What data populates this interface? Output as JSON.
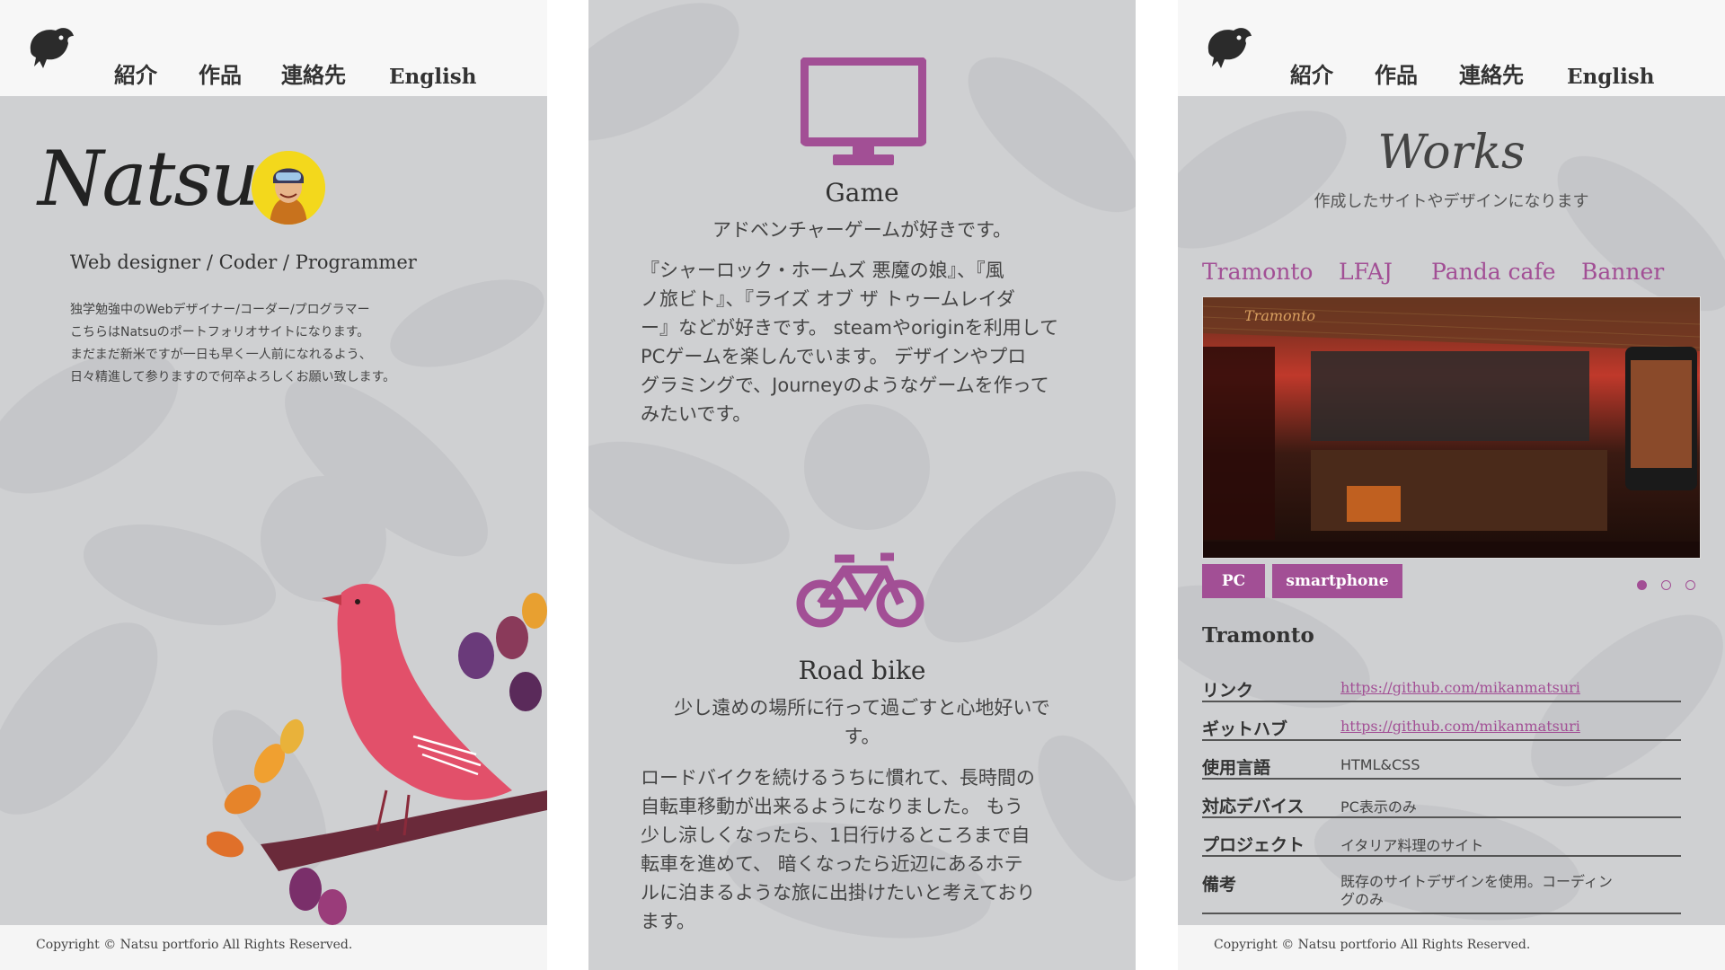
{
  "colors": {
    "accent": "#a24f95",
    "panel_bg": "#cfd0d2",
    "header_bg": "#f7f7f7"
  },
  "nav": {
    "intro": "紹介",
    "works": "作品",
    "contact": "連絡先",
    "english": "English"
  },
  "footer": {
    "copyright": "Copyright © Natsu portforio All Rights Reserved."
  },
  "profile": {
    "name": "Natsu",
    "roles": "Web designer / Coder / Programmer",
    "intro_lines": [
      "独学勉強中のWebデザイナー/コーダー/プログラマー",
      "こちらはNatsuのポートフォリオサイトになります。",
      "まだまだ新米ですが一日も早く一人前になれるよう、",
      "日々精進して参りますので何卒よろしくお願い致します。"
    ]
  },
  "hobbies": [
    {
      "icon": "monitor-icon",
      "title": "Game",
      "subtitle": "アドベンチャーゲームが好きです。",
      "body_lines": [
        "『シャーロック・ホームズ 悪魔の娘』、『風",
        "ノ旅ビト』、『ライズ オブ ザ トゥームレイダ",
        "ー』などが好きです。 steamやoriginを利用して",
        "PCゲームを楽しんでいます。 デザインやプロ",
        "グラミングで、Journeyのようなゲームを作って",
        "みたいです。"
      ]
    },
    {
      "icon": "bicycle-icon",
      "title": "Road bike",
      "subtitle_lines": [
        "少し遠めの場所に行って過ごすと心地好いで",
        "す。"
      ],
      "body_lines": [
        "ロードバイクを続けるうちに慣れて、長時間の",
        "自転車移動が出来るようになりました。 もう",
        "少し涼しくなったら、1日行けるところまで自",
        "転車を進めて、 暗くなったら近辺にあるホテ",
        "ルに泊まるような旅に出掛けたいと考えており",
        "ます。"
      ]
    }
  ],
  "works": {
    "title": "Works",
    "subtitle": "作成したサイトやデザインになります",
    "tabs": [
      "Tramonto",
      "LFAJ",
      "Panda cafe",
      "Banner"
    ],
    "screenshot_title": "Tramonto",
    "view_buttons": {
      "pc": "PC",
      "smartphone": "smartphone"
    },
    "carousel": {
      "count": 3,
      "active": 1
    },
    "project": {
      "name": "Tramonto",
      "rows": [
        {
          "label": "リンク",
          "value": "https://github.com/mikanmatsuri",
          "link": true
        },
        {
          "label": "ギットハブ",
          "value": "https://github.com/mikanmatsuri",
          "link": true
        },
        {
          "label": "使用言語",
          "value": "HTML&CSS",
          "link": false
        },
        {
          "label": "対応デバイス",
          "value": "PC表示のみ",
          "link": false
        },
        {
          "label": "プロジェクト",
          "value": "イタリア料理のサイト",
          "link": false
        },
        {
          "label": "備考",
          "value": "既存のサイトデザインを使用。コーディン",
          "value2": "グのみ",
          "link": false
        }
      ]
    }
  }
}
